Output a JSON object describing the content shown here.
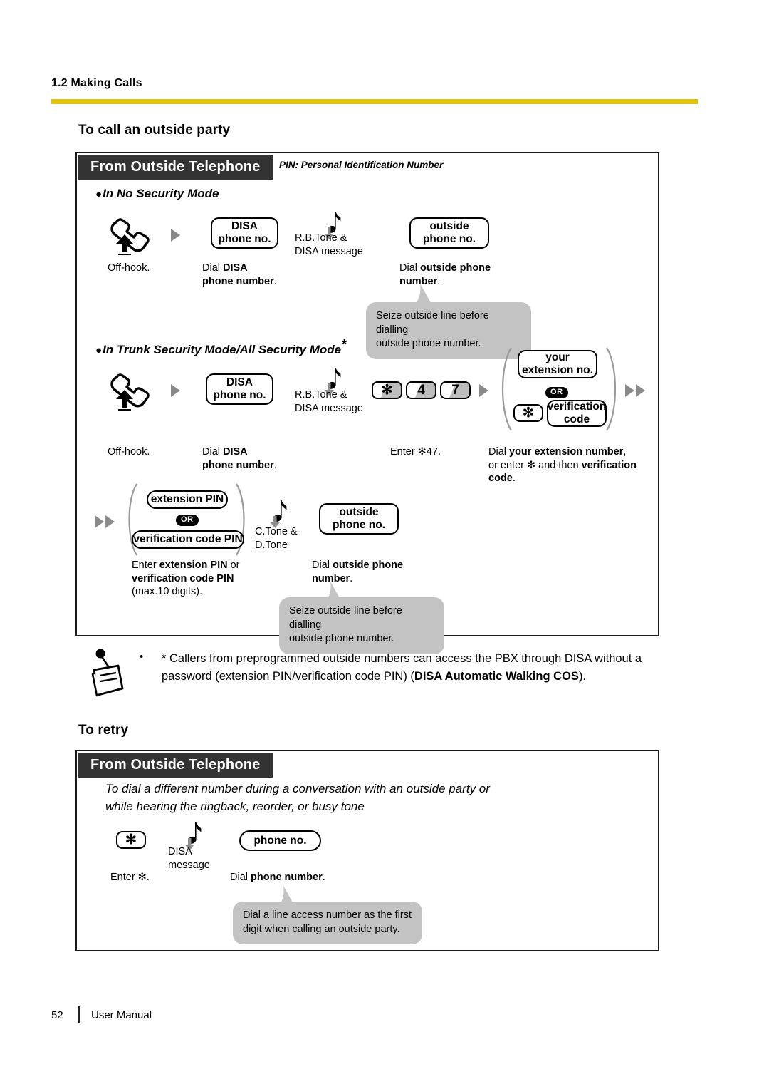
{
  "header": {
    "section_number_title": "1.2 Making Calls",
    "rule_color": "#E0C20F"
  },
  "sections": [
    {
      "title": "To call an outside party",
      "banner": "From Outside Telephone",
      "legend": "PIN: Personal Identification Number",
      "modes": [
        {
          "label": "In No Security Mode"
        },
        {
          "label": "In Trunk Security Mode/All Security Mode"
        }
      ]
    },
    {
      "title": "To retry",
      "banner": "From Outside Telephone",
      "intro_line1": "To dial a different number during a conversation with an outside party or",
      "intro_line2": "while hearing the ringback, reorder, or busy tone"
    }
  ],
  "flow_no_security": {
    "step_offhook_caption": "Off-hook.",
    "disa_box_line1": "DISA",
    "disa_box_line2": "phone no.",
    "disa_caption_line1_plain": "Dial ",
    "disa_caption_line1_bold": "DISA",
    "disa_caption_line2_bold": "phone number",
    "disa_caption_line2_end": ".",
    "tone_line1": "R.B.Tone &",
    "tone_line2": "DISA message",
    "outside_box_line1": "outside",
    "outside_box_line2": "phone no.",
    "outside_caption_line1_plain": "Dial ",
    "outside_caption_line1_bold": "outside phone",
    "outside_caption_line2_bold": "number",
    "outside_caption_line2_end": ".",
    "bubble_line1": "Seize outside line before dialling",
    "bubble_line2": "outside phone number."
  },
  "flow_trunk_security": {
    "step_offhook_caption": "Off-hook.",
    "disa_box_line1": "DISA",
    "disa_box_line2": "phone no.",
    "disa_caption_line1_plain": "Dial ",
    "disa_caption_line1_bold": "DISA",
    "disa_caption_line2_bold": "phone number",
    "disa_caption_line2_end": ".",
    "tone_line1": "R.B.Tone &",
    "tone_line2": "DISA message",
    "keys": [
      "✻",
      "4",
      "7"
    ],
    "keys_caption": "Enter ✻47.",
    "ext_box_line1": "your",
    "ext_box_line2": "extension no.",
    "or_badge": "OR",
    "star_key": "✻",
    "verif_box_line1": "verification",
    "verif_box_line2": "code",
    "ext_caption_l1_plain": "Dial ",
    "ext_caption_l1_bold": "your extension number",
    "ext_caption_l1_end": ",",
    "ext_caption_l2_plain": "or enter ✻ and then ",
    "ext_caption_l2_bold": "verification",
    "ext_caption_l3_bold": "code",
    "ext_caption_l3_end": "."
  },
  "flow_pin": {
    "pin_box": "extension PIN",
    "or_badge": "OR",
    "verif_pin_box": "verification code PIN",
    "tone_line1": "C.Tone &",
    "tone_line2": "D.Tone",
    "pin_caption_l1_plain": "Enter ",
    "pin_caption_l1_bold": "extension PIN",
    "pin_caption_l1_end": " or",
    "pin_caption_l2_bold": "verification code PIN",
    "pin_caption_l3": "(max.10 digits).",
    "outside_box_line1": "outside",
    "outside_box_line2": "phone no.",
    "outside_caption_line1_plain": "Dial ",
    "outside_caption_line1_bold": "outside phone",
    "outside_caption_line2_bold": "number",
    "outside_caption_line2_end": ".",
    "bubble_line1": "Seize outside line before dialling",
    "bubble_line2": "outside phone number."
  },
  "note": {
    "bullet": "•",
    "line1": "* Callers from preprogrammed outside numbers can access the PBX through DISA without a",
    "line2_plain_a": "password (extension PIN/verification code PIN) (",
    "line2_bold": "DISA Automatic Walking COS",
    "line2_plain_b": ")."
  },
  "flow_retry": {
    "star_key": "✻",
    "star_caption": "Enter ✻.",
    "tone_line1": "DISA",
    "tone_line2": "message",
    "phone_box": "phone no.",
    "phone_caption_plain": "Dial ",
    "phone_caption_bold": "phone number",
    "phone_caption_end": ".",
    "bubble_line1": "Dial a line access number as the first",
    "bubble_line2": "digit when calling an outside party."
  },
  "footer": {
    "page_number": "52",
    "label": "User Manual"
  }
}
